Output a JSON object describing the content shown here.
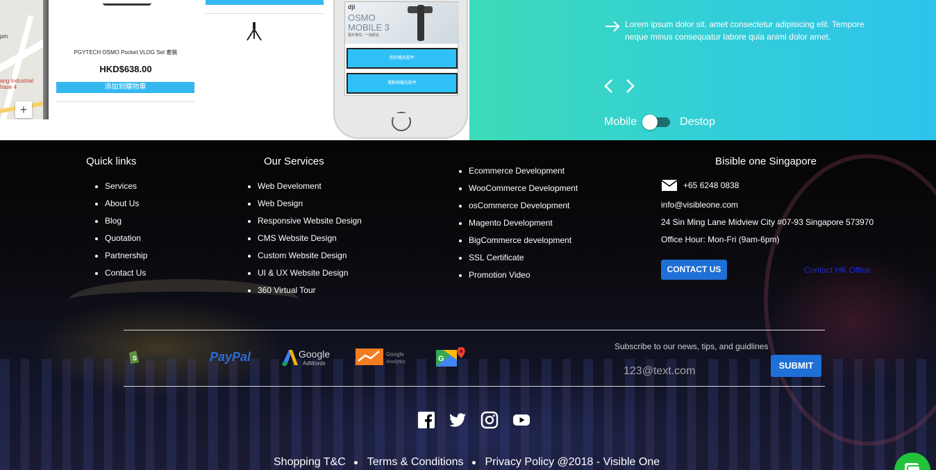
{
  "showcase": {
    "map": {
      "time_text": "pm",
      "label_text": "ang Industrial\nhase 4",
      "zoom_label": "+"
    },
    "product": {
      "name": "PGYTECH OSMO Pocket VLOG Set 套裝",
      "price": "HKD$638.00",
      "button_label": "添加到購物車"
    },
    "phone": {
      "brand": "dji",
      "title_line1": "OSMO",
      "title_line2": "MOBILE 3",
      "subtitle": "隨手掌控，一拍即合",
      "button1": "航拍機及配件",
      "button2": "運動相機及配件"
    },
    "description": "Lorem ipsum dolor sit, amet consectetur adipisicing elit. Tempore neque minus consequatur labore quia animi dolor amet.",
    "toggle": {
      "left_label": "Mobile",
      "right_label": "Destop"
    }
  },
  "footer": {
    "quick_links": {
      "title": "Quick links",
      "items": [
        "Services",
        "About Us",
        "Blog",
        "Quotation",
        "Partnership",
        "Contact Us"
      ]
    },
    "services": {
      "title": "Our Services",
      "items": [
        "Web Develoment",
        "Web Design",
        "Responsive Website Design",
        "CMS Website Design",
        "Custom Website Design",
        "UI & UX Website Design",
        "360 Virtual Tour"
      ]
    },
    "services2": {
      "items": [
        "Ecommerce Development",
        "WooCommerce Development",
        "osCommerce Development",
        "Magento Development",
        "BigCommerce development",
        "SSL Certificate",
        "Promotion Video"
      ]
    },
    "singapore": {
      "title": "Bisible one Singapore",
      "phone": "+65 6248 0838",
      "email": "info@visibleone.com",
      "address": "24 Sin Ming Lane Midview City #07-93 Singapore 573970",
      "hours": "Office Hour: Mon-Fri (9am-6pm)",
      "contact_button": "CONTACT US",
      "hk_link": "Contact HK Office"
    },
    "partners": {
      "shopify": "shopify",
      "paypal": "PayPal",
      "adwords_1": "Google",
      "adwords_2": "AdWords",
      "analytics_1": "Google",
      "analytics_2": "Analytics"
    },
    "subscribe": {
      "label": "Subscribe to our news, tips, and guidlines",
      "placeholder": "123@text.com",
      "button": "SUBMIT"
    },
    "bottom": {
      "link1": "Shopping T&C",
      "link2": "Terms & Conditions",
      "link3": "Privacy Policy @2018 - Visible One"
    }
  },
  "colors": {
    "accent_blue": "#1e6fd6",
    "teal_start": "#3ddcb8",
    "teal_end": "#2ec2ec",
    "product_button": "#34b8ef",
    "chat_green": "#22c33b"
  },
  "icons": [
    "arrow-right-icon",
    "chevron-left-icon",
    "chevron-right-icon",
    "mail-icon",
    "facebook-icon",
    "twitter-icon",
    "instagram-icon",
    "youtube-icon",
    "chat-icon"
  ]
}
